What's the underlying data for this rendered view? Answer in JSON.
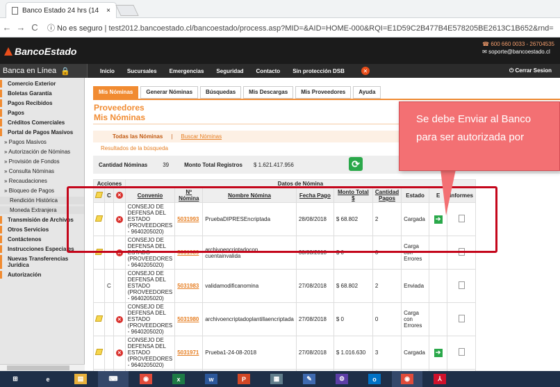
{
  "browser": {
    "tab_title": "Banco Estado 24 hrs (14",
    "tab_close": "×",
    "security": "ⓘ No es seguro",
    "url": "test2012.bancoestado.cl/bancoestado/process.asp?MID=&AID=HOME-000&RQI=E1D59C2B477B4E578205BE2613C1B652&rnd="
  },
  "site": {
    "logo": "BancoEstado",
    "phone": "600 660 0033 - 26704535",
    "email": "soporte@bancoestado.cl",
    "banca": "Banca en Línea",
    "nav": [
      "Inicio",
      "Sucursales",
      "Emergencias",
      "Seguridad",
      "Contacto",
      "Sin protección DSB"
    ],
    "logout": "Cerrar Sesion"
  },
  "sidebar": [
    {
      "label": "Comercio Exterior",
      "kind": "main"
    },
    {
      "label": "Boletas Garantía",
      "kind": "main"
    },
    {
      "label": "Pagos Recibidos",
      "kind": "main"
    },
    {
      "label": "Pagos",
      "kind": "main"
    },
    {
      "label": "Créditos Comerciales",
      "kind": "main"
    },
    {
      "label": "Portal de Pagos Masivos",
      "kind": "main"
    },
    {
      "label": "» Pagos Masivos",
      "kind": "sub"
    },
    {
      "label": "» Autorización de Nóminas",
      "kind": "sub"
    },
    {
      "label": "» Provisión de Fondos",
      "kind": "sub"
    },
    {
      "label": "» Consulta Nóminas",
      "kind": "sub"
    },
    {
      "label": "» Recaudaciones",
      "kind": "sub"
    },
    {
      "label": "» Bloqueo de Pagos",
      "kind": "sub"
    },
    {
      "label": "Rendición Histórica",
      "kind": "sub2"
    },
    {
      "label": "Moneda Extranjera",
      "kind": "sub2"
    },
    {
      "label": "Transmisión de Archivos",
      "kind": "main"
    },
    {
      "label": "Otros Servicios",
      "kind": "main"
    },
    {
      "label": "Contáctenos",
      "kind": "main"
    },
    {
      "label": "Instrucciones Especiales",
      "kind": "main"
    },
    {
      "label": "Nuevas Transferencias Jurídica",
      "kind": "main"
    },
    {
      "label": "Autorización",
      "kind": "main"
    }
  ],
  "tabs": [
    "Mis Nóminas",
    "Generar Nóminas",
    "Búsquedas",
    "Mis Descargas",
    "Mis Proveedores",
    "Ayuda"
  ],
  "page": {
    "title": "Proveedores",
    "subtitle": "Mis Nóminas",
    "subnav_all": "Todas las Nóminas",
    "subnav_sep": "|",
    "subnav_search": "Buscar Nóminas",
    "results": "Resultados de la búsqueda",
    "count_label": "Cantidad Nóminas",
    "count_value": "39",
    "total_label": "Monto Total Registros",
    "total_value": "$ 1.621.417.956"
  },
  "table": {
    "group_actions": "Acciones",
    "group_data": "Datos de Nómina",
    "headers": [
      "Convenio",
      "Nº Nómina",
      "Nombre Nómina",
      "Fecha Pago",
      "Monto Total $",
      "Cantidad Pagos",
      "Estado",
      "E",
      "Informes"
    ],
    "rows": [
      {
        "convenio": "CONSEJO DE DEFENSA DEL ESTADO (PROVEEDORES - 9640205020)",
        "numero": "5031993",
        "nombre": "PruebaDIPRESEncriptada",
        "fecha": "28/08/2018",
        "monto": "$ 68.802",
        "cantidad": "2",
        "estado": "Cargada",
        "edit": true,
        "del": true,
        "redo": false,
        "send": true
      },
      {
        "convenio": "CONSEJO DE DEFENSA DEL ESTADO (PROVEEDORES - 9640205020)",
        "numero": "5031989",
        "nombre": "archivoencriptadocon cuentainvalida",
        "fecha": "30/08/2018",
        "monto": "$ 0",
        "cantidad": "0",
        "estado": "Carga con Errores",
        "edit": true,
        "del": true,
        "redo": false,
        "send": false
      },
      {
        "convenio": "CONSEJO DE DEFENSA DEL ESTADO (PROVEEDORES - 9640205020)",
        "numero": "5031983",
        "nombre": "validamodificanomina",
        "fecha": "27/08/2018",
        "monto": "$ 68.802",
        "cantidad": "2",
        "estado": "Enviada",
        "edit": false,
        "del": false,
        "redo": true,
        "send": false
      },
      {
        "convenio": "CONSEJO DE DEFENSA DEL ESTADO (PROVEEDORES - 9640205020)",
        "numero": "5031980",
        "nombre": "archivoencriptadoplantillaencriptada",
        "fecha": "27/08/2018",
        "monto": "$ 0",
        "cantidad": "0",
        "estado": "Carga con Errores",
        "edit": true,
        "del": true,
        "redo": false,
        "send": false
      },
      {
        "convenio": "CONSEJO DE DEFENSA DEL ESTADO (PROVEEDORES - 9640205020)",
        "numero": "5031971",
        "nombre": "Prueba1-24-08-2018",
        "fecha": "27/08/2018",
        "monto": "$ 1.016.630",
        "cantidad": "3",
        "estado": "Cargada",
        "edit": true,
        "del": true,
        "redo": false,
        "send": true
      },
      {
        "convenio": "CONSEJO DE",
        "numero": "",
        "nombre": "",
        "fecha": "",
        "monto": "",
        "cantidad": "",
        "estado": "",
        "edit": false,
        "del": false,
        "redo": false,
        "send": false
      }
    ]
  },
  "callout": {
    "line1": "Se debe Enviar al Banco",
    "line2": "para ser autorizada por"
  },
  "taskbar": [
    "windows",
    "ie",
    "explorer",
    "app",
    "chrome",
    "excel",
    "word",
    "powerpoint",
    "calculator",
    "pen",
    "settings",
    "outlook",
    "chrome2",
    "acrobat"
  ]
}
